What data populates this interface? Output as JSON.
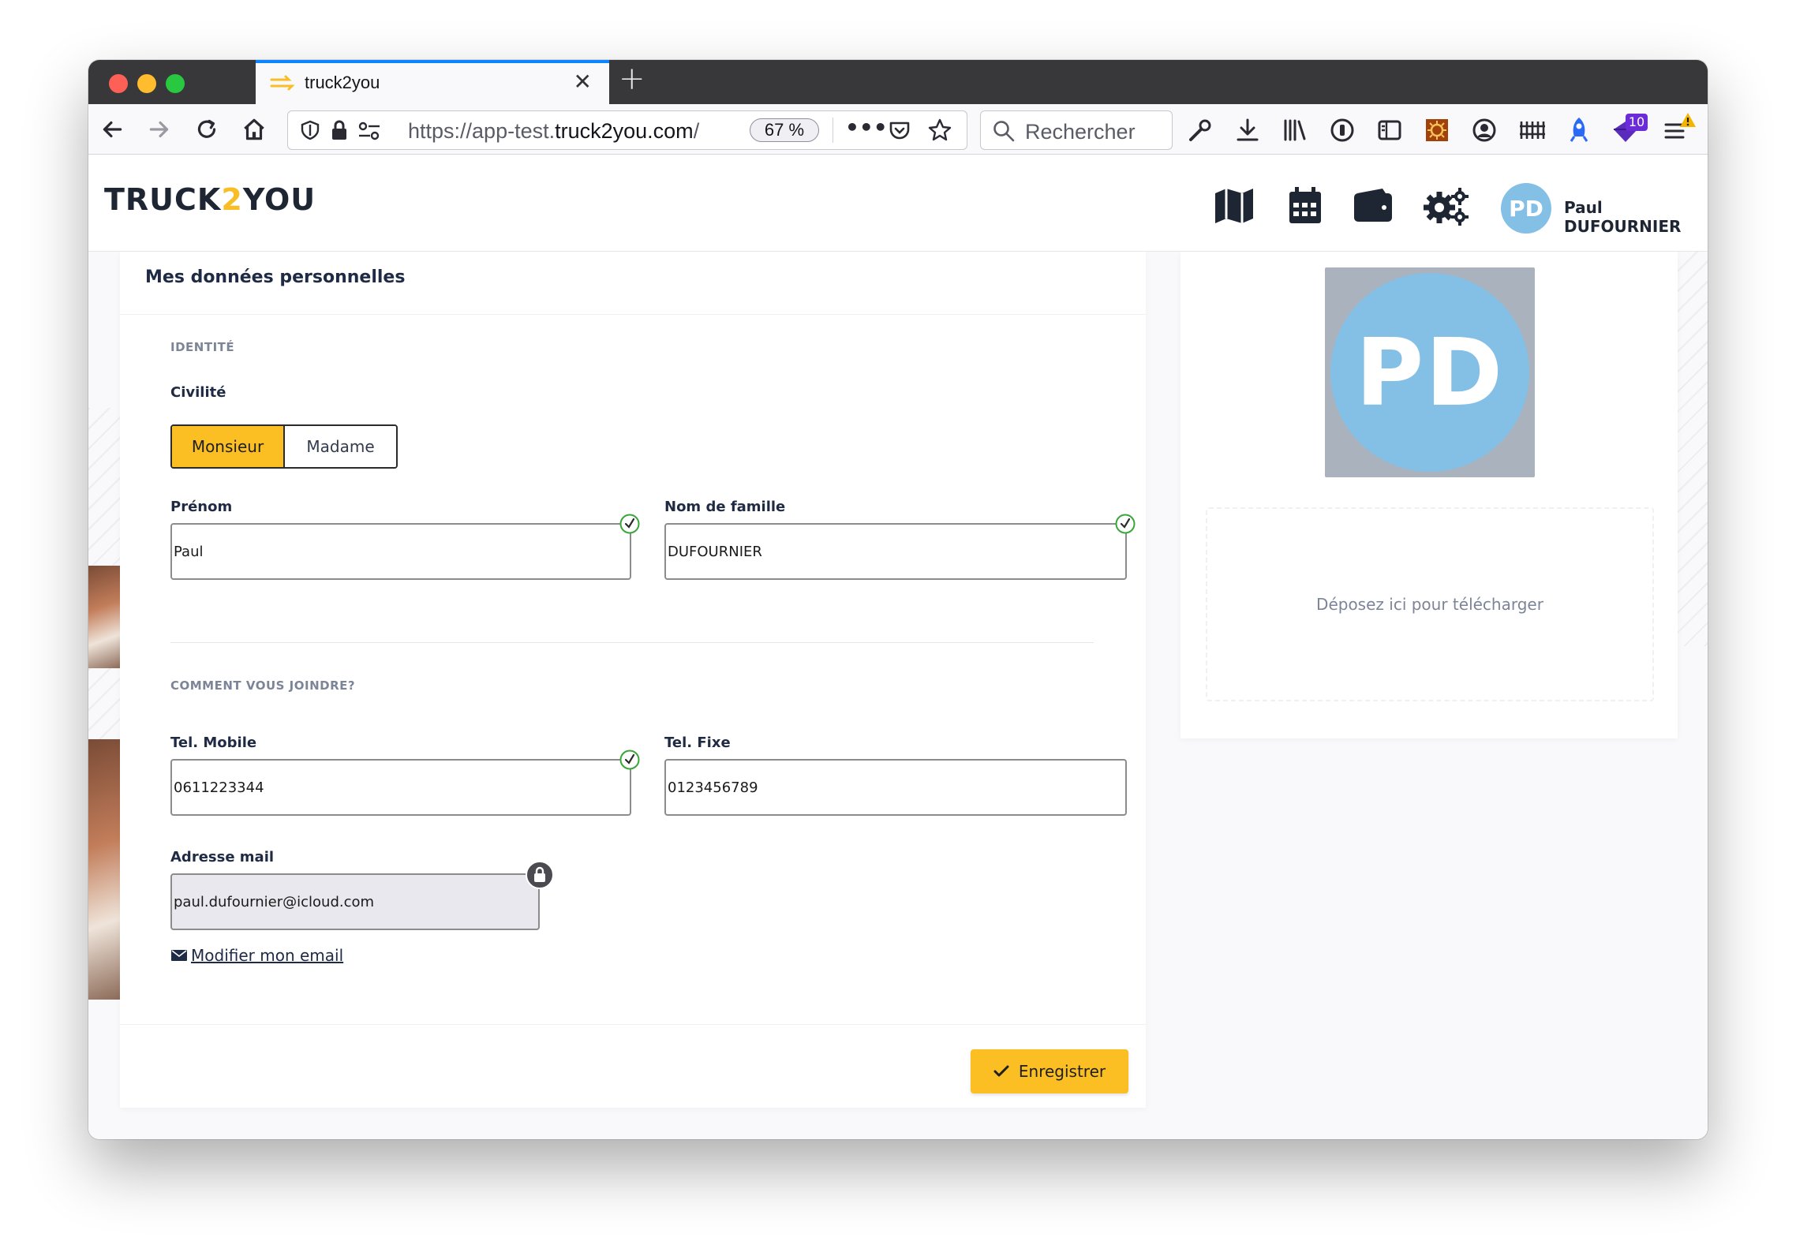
{
  "browser": {
    "tab_title": "truck2you",
    "url_prefix": "https://app-test.",
    "url_domain": "truck2you.com",
    "url_suffix": "/",
    "zoom": "67 %",
    "search_placeholder": "Rechercher",
    "notification_count": "10"
  },
  "app": {
    "logo": {
      "part1": "TRUCK",
      "part2": "2",
      "part3": "YOU"
    },
    "user": {
      "initials": "PD",
      "name": "Paul DUFOURNIER"
    },
    "colors": {
      "accent": "#fbbf24",
      "avatar": "#84bfe6",
      "text_dark": "#1f2a44",
      "muted": "#7c8597"
    }
  },
  "card": {
    "title": "Mes données personnelles",
    "identity_section": "IDENTITÉ",
    "civility_label": "Civilité",
    "civility_options": [
      "Monsieur",
      "Madame"
    ],
    "civility_selected": "Monsieur",
    "first_name_label": "Prénom",
    "first_name_value": "Paul",
    "last_name_label": "Nom de famille",
    "last_name_value": "DUFOURNIER",
    "contact_section": "COMMENT VOUS JOINDRE?",
    "mobile_label": "Tel. Mobile",
    "mobile_value": "0611223344",
    "landline_label": "Tel. Fixe",
    "landline_value": "0123456789",
    "email_label": "Adresse mail",
    "email_value": "paul.dufournier@icloud.com",
    "change_email_link": "Modifier mon email",
    "save_label": "Enregistrer"
  },
  "side": {
    "photo_initials": "PD",
    "dropzone_text": "Déposez ici pour télécharger"
  }
}
